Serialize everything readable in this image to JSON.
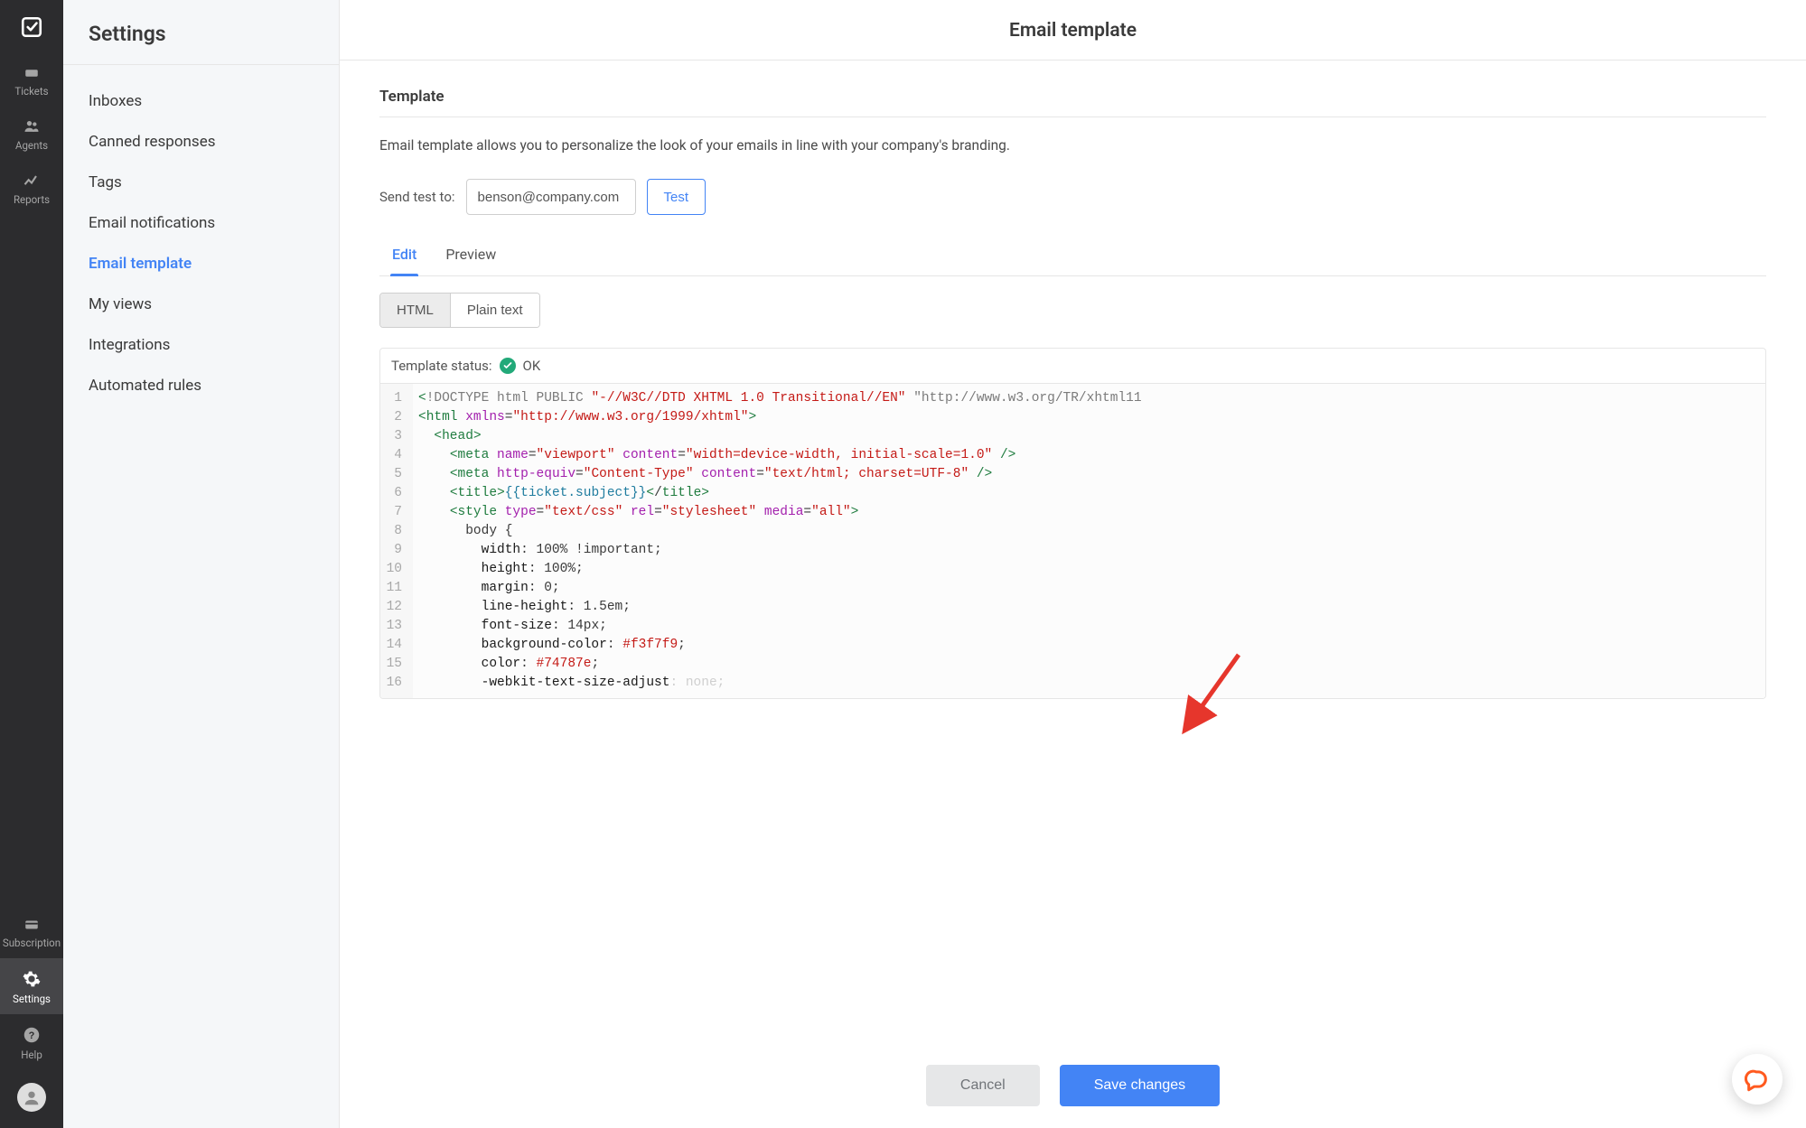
{
  "nav": {
    "items": [
      {
        "id": "tickets",
        "label": "Tickets"
      },
      {
        "id": "agents",
        "label": "Agents"
      },
      {
        "id": "reports",
        "label": "Reports"
      }
    ],
    "bottom_items": [
      {
        "id": "subscription",
        "label": "Subscription"
      },
      {
        "id": "settings",
        "label": "Settings"
      },
      {
        "id": "help",
        "label": "Help"
      }
    ]
  },
  "settings_sidebar": {
    "title": "Settings",
    "items": [
      {
        "label": "Inboxes"
      },
      {
        "label": "Canned responses"
      },
      {
        "label": "Tags"
      },
      {
        "label": "Email notifications"
      },
      {
        "label": "Email template"
      },
      {
        "label": "My views"
      },
      {
        "label": "Integrations"
      },
      {
        "label": "Automated rules"
      }
    ],
    "active_index": 4
  },
  "main": {
    "page_title": "Email template",
    "section_title": "Template",
    "description": "Email template allows you to personalize the look of your emails in line with your company's branding.",
    "send_test": {
      "label": "Send test to:",
      "value": "benson@company.com",
      "button": "Test"
    },
    "tabs": [
      {
        "label": "Edit"
      },
      {
        "label": "Preview"
      }
    ],
    "tabs_active_index": 0,
    "format_tabs": [
      {
        "label": "HTML"
      },
      {
        "label": "Plain text"
      }
    ],
    "format_active_index": 0,
    "status": {
      "label": "Template status:",
      "value": "OK"
    },
    "code_lines": [
      "<!DOCTYPE html PUBLIC \"-//W3C//DTD XHTML 1.0 Transitional//EN\" \"http://www.w3.org/TR/xhtml11",
      "<html xmlns=\"http://www.w3.org/1999/xhtml\">",
      "  <head>",
      "    <meta name=\"viewport\" content=\"width=device-width, initial-scale=1.0\" />",
      "    <meta http-equiv=\"Content-Type\" content=\"text/html; charset=UTF-8\" />",
      "    <title>{{ticket.subject}}</title>",
      "    <style type=\"text/css\" rel=\"stylesheet\" media=\"all\">",
      "      body {",
      "        width: 100% !important;",
      "        height: 100%;",
      "        margin: 0;",
      "        line-height: 1.5em;",
      "        font-size: 14px;",
      "        background-color: #f3f7f9;",
      "        color: #74787e;",
      "        -webkit-text-size-adjust: none;"
    ]
  },
  "footer": {
    "cancel": "Cancel",
    "save": "Save changes"
  }
}
